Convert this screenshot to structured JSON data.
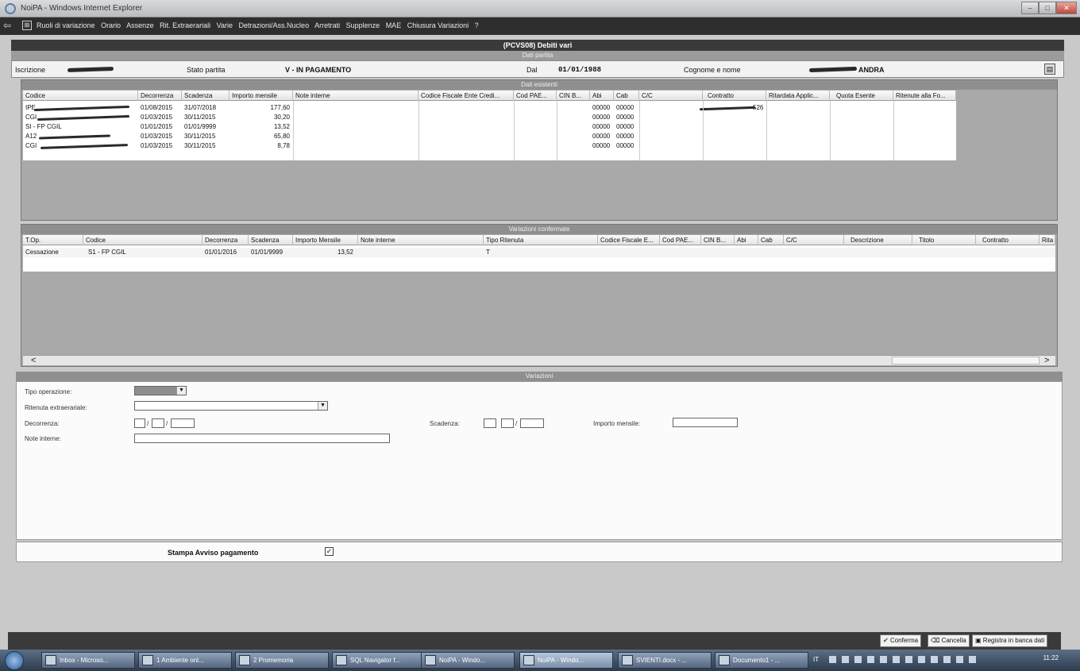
{
  "window": {
    "title": "NoiPA - Windows Internet Explorer"
  },
  "menu": [
    "Ruoli di variazione",
    "Orario",
    "Assenze",
    "Rit. Extraerariali",
    "Varie",
    "Detrazioni/Ass.Nucleo",
    "Arretrati",
    "Supplenze",
    "MAE",
    "Chiusura Variazioni",
    "?"
  ],
  "page": {
    "title": "(PCVS08) Debiti vari"
  },
  "dati_partita": {
    "section": "Dati partita",
    "iscrizione_label": "Iscrizione",
    "stato_label": "Stato partita",
    "stato_value": "V - IN PAGAMENTO",
    "dal_label": "Dal",
    "dal_value": "01/01/1988",
    "cognome_label": "Cognome e nome",
    "cognome_value": "ANDRA"
  },
  "dati_esistenti": {
    "section": "Dati esistenti",
    "columns": [
      "Codice",
      "Decorrenza",
      "Scadenza",
      "Importo mensile",
      "Note interne",
      "Codice Fiscale Ente Credi...",
      "Cod PAE...",
      "CIN B...",
      "Abi",
      "Cab",
      "C/C",
      "Contratto",
      "Ritardata Applic...",
      "Quota Esente",
      "Ritenute alla Fo..."
    ],
    "rows": [
      {
        "codice": "IPE",
        "decorrenza": "01/08/2015",
        "scadenza": "31/07/2018",
        "importo": "177,60",
        "abi": "00000",
        "cab": "00000",
        "contratto": "526"
      },
      {
        "codice": "CGI",
        "decorrenza": "01/03/2015",
        "scadenza": "30/11/2015",
        "importo": "30,20",
        "abi": "00000",
        "cab": "00000",
        "contratto": ""
      },
      {
        "codice": "SI - FP CGIL",
        "decorrenza": "01/01/2015",
        "scadenza": "01/01/9999",
        "importo": "13,52",
        "abi": "00000",
        "cab": "00000",
        "contratto": ""
      },
      {
        "codice": "A12",
        "decorrenza": "01/03/2015",
        "scadenza": "30/11/2015",
        "importo": "65,80",
        "abi": "00000",
        "cab": "00000",
        "contratto": ""
      },
      {
        "codice": "CGI",
        "decorrenza": "01/03/2015",
        "scadenza": "30/11/2015",
        "importo": "8,78",
        "abi": "00000",
        "cab": "00000",
        "contratto": ""
      }
    ]
  },
  "variazioni_confermate": {
    "section": "Variazioni confermate",
    "columns": [
      "T.Op.",
      "Codice",
      "Decorrenza",
      "Scadenza",
      "Importo Mensile",
      "Note interne",
      "Tipo Ritenuta",
      "Codice Fiscale E...",
      "Cod PAE...",
      "CIN B...",
      "Abi",
      "Cab",
      "C/C",
      "Descrizione",
      "Titolo",
      "Contratto",
      "Rita"
    ],
    "rows": [
      {
        "top": "Cessazione",
        "codice": "S1 - FP CGIL",
        "decorrenza": "01/01/2016",
        "scadenza": "01/01/9999",
        "importo": "13,52",
        "tipo": "T"
      }
    ],
    "scroll_left": "<",
    "scroll_right": ">"
  },
  "variazioni": {
    "section": "Variazioni",
    "tipo_operazione_label": "Tipo operazione:",
    "ritenuta_label": "Ritenuta extraerariale:",
    "decorrenza_label": "Decorrenza:",
    "scadenza_label": "Scadenza:",
    "importo_label": "Importo mensile:",
    "note_label": "Note interne:",
    "date_sep": "/"
  },
  "stampa": {
    "label": "Stampa Avviso pagamento",
    "checked": "✓"
  },
  "toolbar": {
    "conferma": "Conferma",
    "cancella": "Cancella",
    "registra": "Registra in banca dati"
  },
  "taskbar": {
    "tasks": [
      "Inbox - Microso...",
      "1 Ambiente onl...",
      "2 Promemoria",
      "SQL Navigator f...",
      "NoiPA - Windo...",
      "NoiPA - Windo...",
      "SVIENTI.docx - ...",
      "Documento1 - ..."
    ],
    "lang": "IT",
    "clock": "11:22"
  }
}
